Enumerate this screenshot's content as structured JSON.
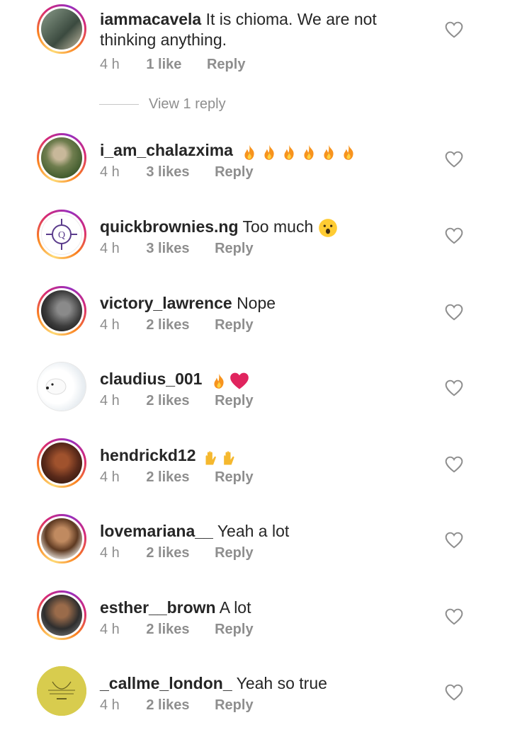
{
  "comments": [
    {
      "username": "iammacavela",
      "text": "It is chioma. We are not thinking anything.",
      "time": "4 h",
      "likes": "1 like",
      "reply": "Reply"
    },
    {
      "username": "i_am_chalazxima",
      "text": "",
      "time": "4 h",
      "likes": "3 likes",
      "reply": "Reply"
    },
    {
      "username": "quickbrownies.ng",
      "text": "Too much",
      "time": "4 h",
      "likes": "3 likes",
      "reply": "Reply"
    },
    {
      "username": "victory_lawrence",
      "text": "Nope",
      "time": "4 h",
      "likes": "2 likes",
      "reply": "Reply"
    },
    {
      "username": "claudius_001",
      "text": "",
      "time": "4 h",
      "likes": "2 likes",
      "reply": "Reply"
    },
    {
      "username": "hendrickd12",
      "text": "",
      "time": "4 h",
      "likes": "2 likes",
      "reply": "Reply"
    },
    {
      "username": "lovemariana__",
      "text": "Yeah a lot",
      "time": "4 h",
      "likes": "2 likes",
      "reply": "Reply"
    },
    {
      "username": "esther__brown",
      "text": "A lot",
      "time": "4 h",
      "likes": "2 likes",
      "reply": "Reply"
    },
    {
      "username": "_callme_london_",
      "text": "Yeah so true",
      "time": "4 h",
      "likes": "2 likes",
      "reply": "Reply"
    }
  ],
  "view_replies": "View 1 reply",
  "icons": {
    "like": "heart-outline-icon",
    "fire": "fire-emoji-icon",
    "heart_red": "red-heart-emoji-icon",
    "wow": "astonished-face-emoji-icon",
    "hands": "raised-hands-emoji-icon"
  },
  "colors": {
    "meta_text": "#8e8e8e",
    "story_ring": "#d62976",
    "heart_red": "#e0245e"
  }
}
